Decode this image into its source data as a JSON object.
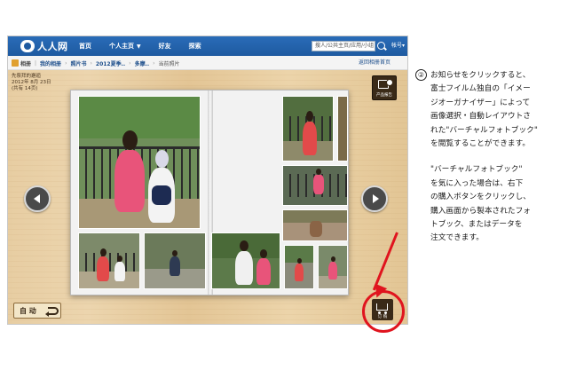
{
  "header": {
    "logo_text": "人人网",
    "nav": [
      {
        "label": "首页",
        "caret": false
      },
      {
        "label": "个人主页",
        "caret": true
      },
      {
        "label": "好友",
        "caret": false
      },
      {
        "label": "探索",
        "caret": false
      }
    ],
    "search_placeholder": "搜人/公共主页/应用/小组",
    "account": "帐号▾"
  },
  "breadcrumb": {
    "items": [
      "相册",
      "我的相册",
      "照片书",
      "2012夏季..",
      "多摩..",
      "当前照片"
    ],
    "back_link": "返回相册首页"
  },
  "viewer": {
    "album_meta": [
      "先祭拜的邂逅",
      "2012年 8月 23日",
      "(共有 14页)"
    ],
    "corner_button_label": "产品报告",
    "auto_label": "自 动",
    "cart_label": "订 购"
  },
  "annotation": {
    "number": "②",
    "para1": [
      "お知らせをクリックすると、",
      "富士フイルム独自の「イメー",
      "ジオーガナイザー」によって",
      "画像選択・自動レイアウトさ",
      "れた\"バーチャルフォトブック\"",
      "を閲覧することができます。"
    ],
    "para2": [
      "\"バーチャルフォトブック\"",
      "を気に入った場合は、右下",
      "の購入ボタンをクリックし、",
      "購入画面から製本されたフォ",
      "トブック、またはデータを",
      "注文できます。"
    ]
  },
  "colors": {
    "nav_blue": "#1e5aa0",
    "wood": "#e7cda2",
    "accent_red": "#e0141e",
    "button_dark": "#3a2a18"
  }
}
